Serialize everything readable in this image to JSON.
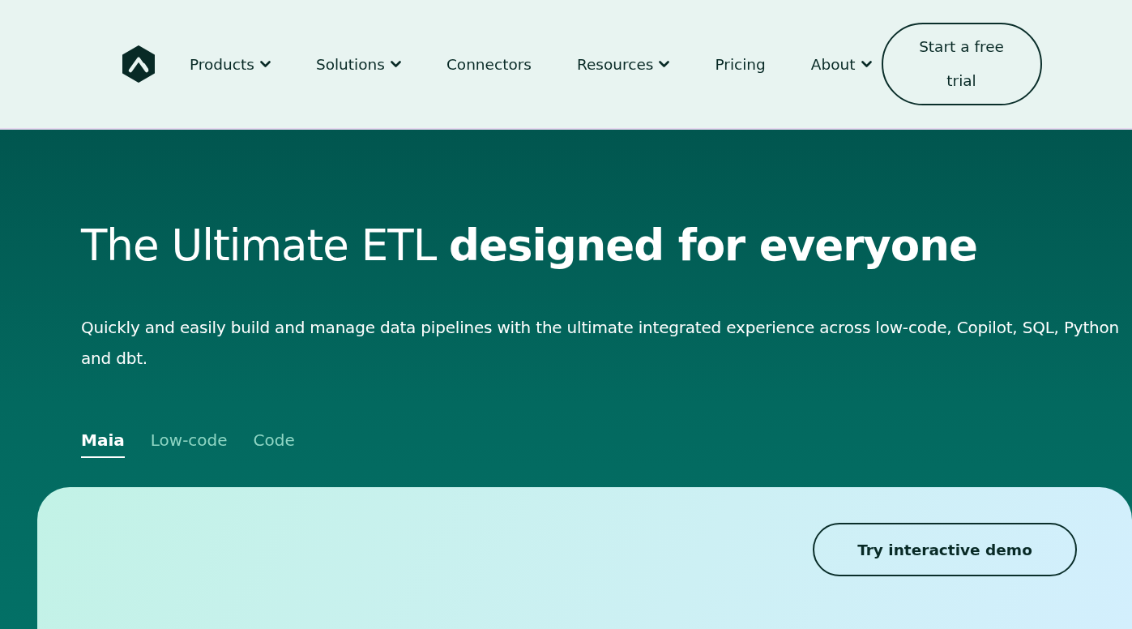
{
  "nav": {
    "items": [
      {
        "label": "Products",
        "dropdown": true
      },
      {
        "label": "Solutions",
        "dropdown": true
      },
      {
        "label": "Connectors",
        "dropdown": false
      },
      {
        "label": "Resources",
        "dropdown": true
      },
      {
        "label": "Pricing",
        "dropdown": false
      },
      {
        "label": "About",
        "dropdown": true
      }
    ],
    "cta": "Start a free trial"
  },
  "hero": {
    "headline": "The Ultimate ETL **designed for everyone**",
    "subtitle": "Quickly and easily build and manage data pipelines with the ultimate integrated experience across low-code, Copilot, SQL, Python and dbt.",
    "tabs": [
      {
        "label": "Maia",
        "selected": true
      },
      {
        "label": "Low-code",
        "selected": false
      },
      {
        "label": "Code",
        "selected": false
      }
    ]
  },
  "demo_card": {
    "button": "Try interactive demo"
  }
}
